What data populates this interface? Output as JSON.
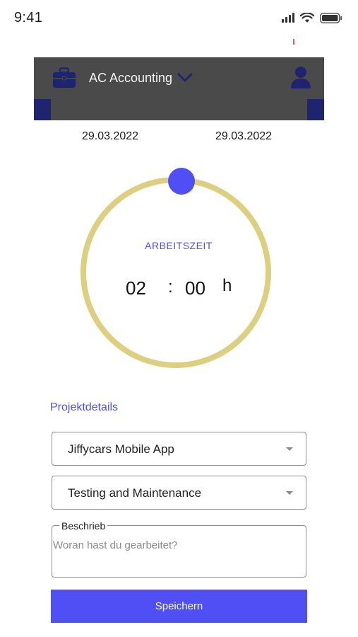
{
  "status_bar": {
    "time": "9:41",
    "icons": [
      "signal-icon",
      "wifi-icon",
      "battery-icon"
    ]
  },
  "header": {
    "company": "AC Accounting",
    "icons": [
      "briefcase-icon",
      "chevron-down-icon",
      "user-icon"
    ],
    "background_color": "#4a4a4a",
    "accent_color": "#1f2470"
  },
  "dates": {
    "start": "29.03.2022",
    "end": "29.03.2022"
  },
  "timer": {
    "label": "ARBEITSZEIT",
    "hours": "02",
    "separator": ":",
    "minutes": "00",
    "unit": "h",
    "ring_color": "#dccf80",
    "knob_color": "#4f4ff5"
  },
  "project_details": {
    "title": "Projektdetails",
    "project_select": {
      "value": "Jiffycars Mobile App"
    },
    "task_select": {
      "value": "Testing and Maintenance"
    },
    "description": {
      "legend": "Beschrieb",
      "placeholder": "Woran hast du gearbeitet?",
      "value": ""
    }
  },
  "actions": {
    "save_label": "Speichern",
    "save_color": "#4f4ff5"
  }
}
